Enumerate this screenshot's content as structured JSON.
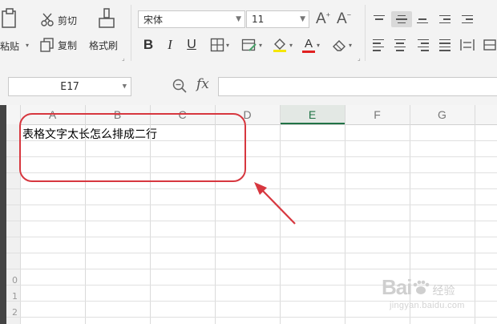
{
  "ribbon": {
    "clipboard": {
      "cut": "剪切",
      "paste": "粘贴",
      "copy": "复制",
      "format_painter": "格式刷"
    },
    "font": {
      "name": "宋体",
      "size": "11",
      "bold": "B",
      "italic": "I",
      "underline": "U",
      "font_color_glyph": "A"
    }
  },
  "formula_bar": {
    "cell_ref": "E17",
    "fx_label": "fx",
    "formula": ""
  },
  "sheet": {
    "columns": [
      "A",
      "B",
      "C",
      "D",
      "E",
      "F",
      "G"
    ],
    "selected_column": "E",
    "row_numbers": [
      "0",
      "1",
      "2"
    ],
    "cell_text": "表格文字太长怎么排成二行"
  },
  "watermark": {
    "brand": "Bai",
    "brand_suffix": "经验",
    "url": "jingyan.baidu.com"
  },
  "colors": {
    "annotation": "#d7373f",
    "selection_green": "#217346",
    "font_color_bar": "#e02020",
    "fill_color_bar": "#f5e600"
  }
}
